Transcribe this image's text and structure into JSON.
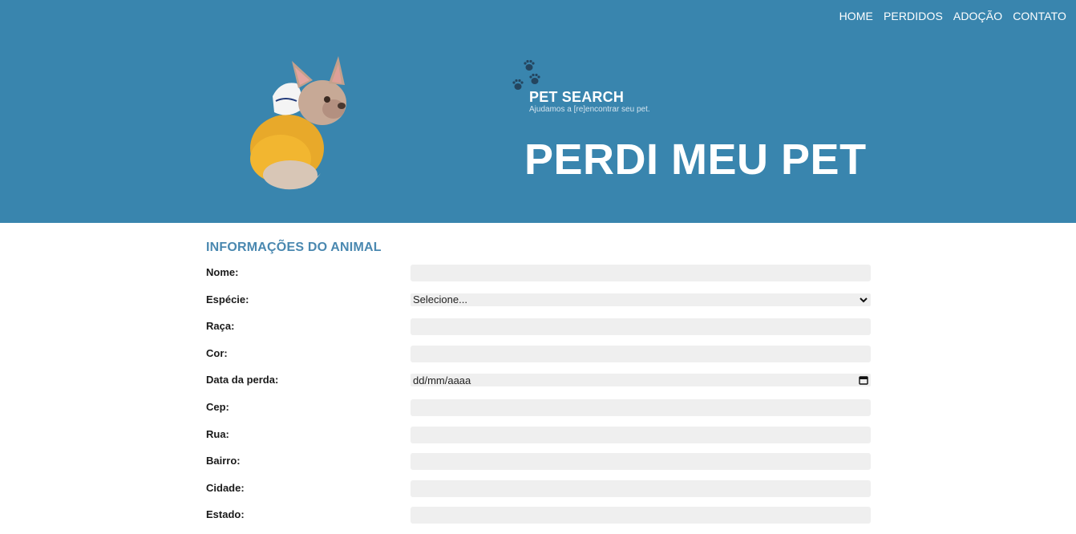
{
  "nav": {
    "items": [
      "HOME",
      "PERDIDOS",
      "ADOÇÃO",
      "CONTATO"
    ]
  },
  "brand": {
    "title": "PET SEARCH",
    "subtitle": "Ajudamos a [re]encontrar seu pet."
  },
  "hero": {
    "title": "PERDI MEU PET",
    "image": "french-bulldog-in-yellow-hoodie",
    "paw_icon": "paw-prints-icon"
  },
  "form": {
    "section_title": "INFORMAÇÕES DO ANIMAL",
    "fields": {
      "nome": {
        "label": "Nome:",
        "value": ""
      },
      "especie": {
        "label": "Espécie:",
        "value": "Selecione..."
      },
      "raca": {
        "label": "Raça:",
        "value": ""
      },
      "cor": {
        "label": "Cor:",
        "value": ""
      },
      "data": {
        "label": "Data da perda:",
        "value": "dd/mm/aaaa"
      },
      "cep": {
        "label": "Cep:",
        "value": ""
      },
      "rua": {
        "label": "Rua:",
        "value": ""
      },
      "bairro": {
        "label": "Bairro:",
        "value": ""
      },
      "cidade": {
        "label": "Cidade:",
        "value": ""
      },
      "estado": {
        "label": "Estado:",
        "value": ""
      }
    }
  },
  "colors": {
    "hero_bg": "#3985ae",
    "accent_heading": "#4a88b0",
    "field_bg": "#efefef"
  }
}
